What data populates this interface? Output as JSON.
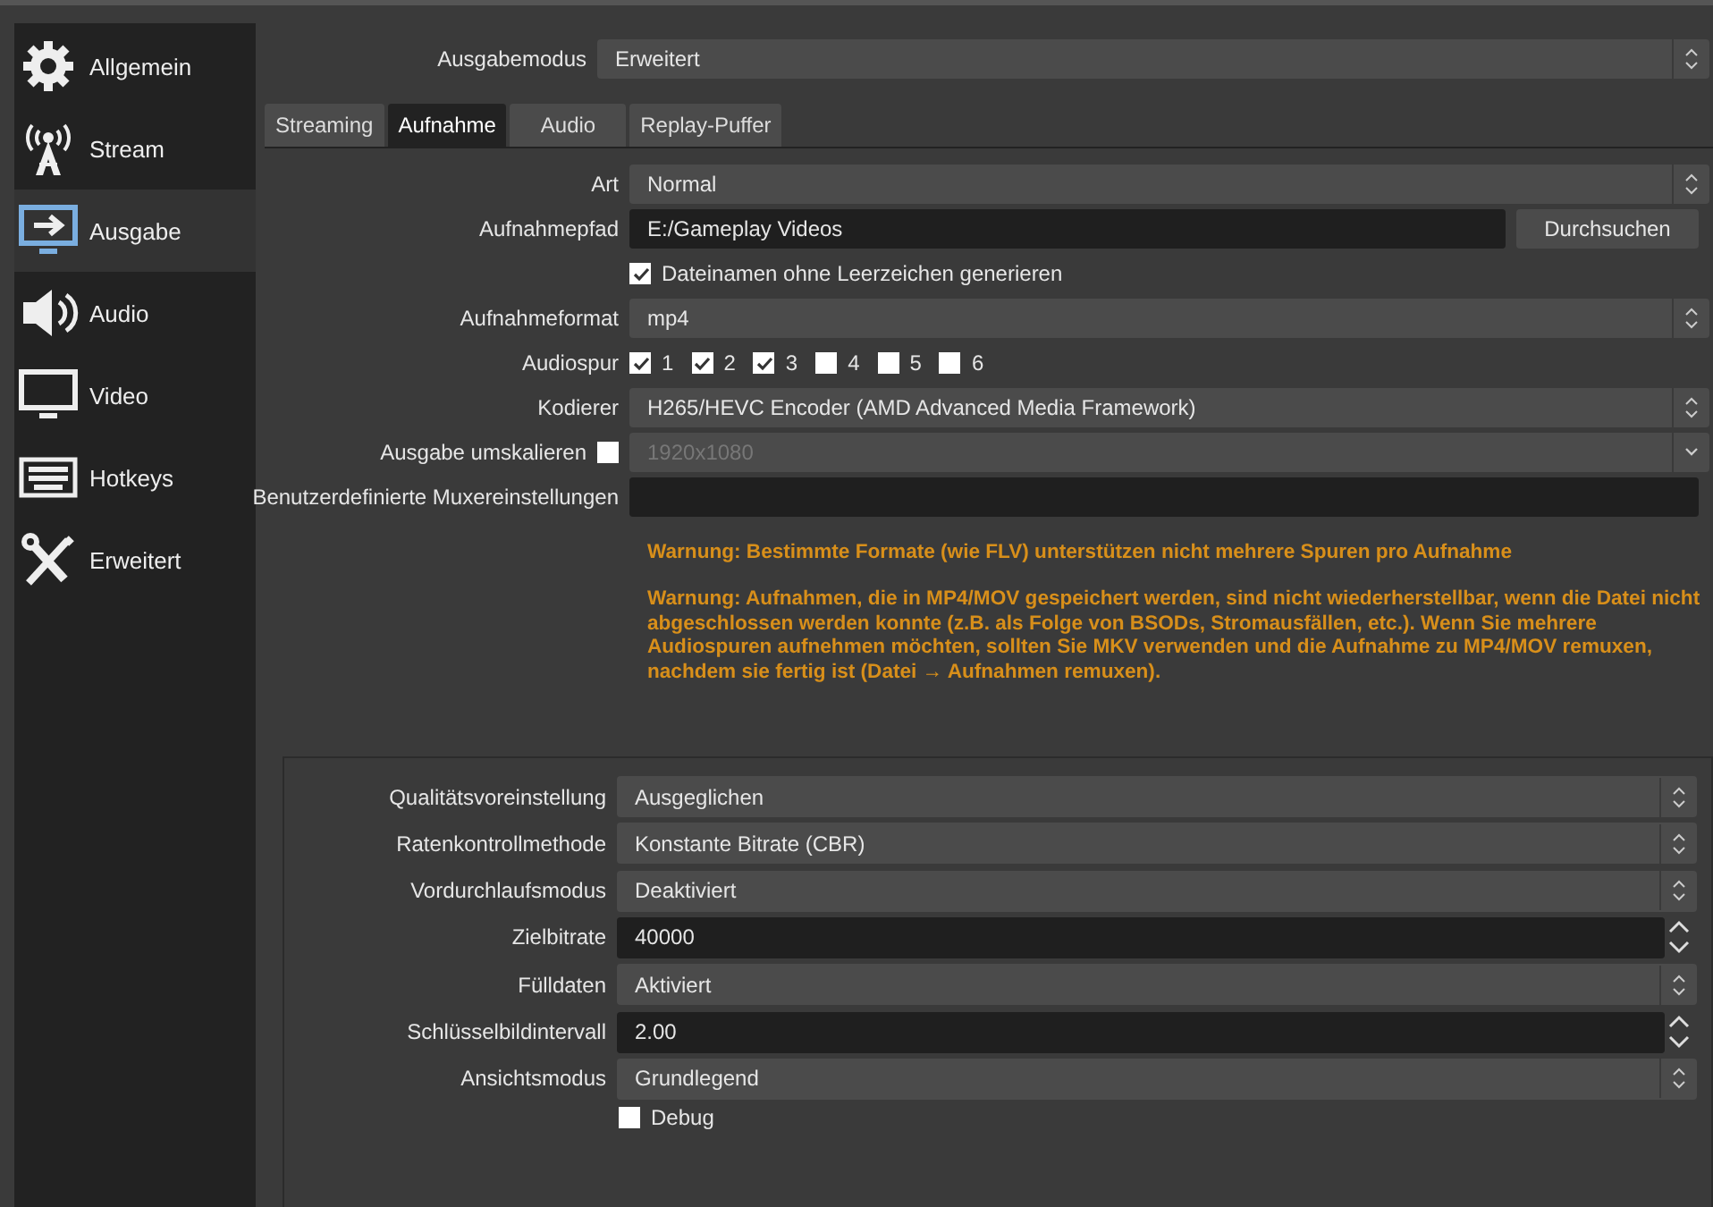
{
  "sidebar": {
    "items": [
      {
        "kind": "gear",
        "label": "Allgemein",
        "selected": false
      },
      {
        "kind": "antenna",
        "label": "Stream",
        "selected": false
      },
      {
        "kind": "output",
        "label": "Ausgabe",
        "selected": true
      },
      {
        "kind": "speaker",
        "label": "Audio",
        "selected": false
      },
      {
        "kind": "monitor",
        "label": "Video",
        "selected": false
      },
      {
        "kind": "keyboard",
        "label": "Hotkeys",
        "selected": false
      },
      {
        "kind": "tools",
        "label": "Erweitert",
        "selected": false
      }
    ]
  },
  "output_mode": {
    "label": "Ausgabemodus",
    "value": "Erweitert"
  },
  "tabs": [
    {
      "label": "Streaming",
      "selected": false
    },
    {
      "label": "Aufnahme",
      "selected": true
    },
    {
      "label": "Audio",
      "selected": false
    },
    {
      "label": "Replay-Puffer",
      "selected": false
    }
  ],
  "recording": {
    "rows": [
      {
        "kind": "combo",
        "label": "Art",
        "value": "Normal"
      },
      {
        "kind": "path",
        "label": "Aufnahmepfad",
        "value": "E:/Gameplay Videos",
        "button": "Durchsuchen"
      },
      {
        "kind": "checkbox",
        "label": "Dateinamen ohne Leerzeichen generieren",
        "checked": true
      },
      {
        "kind": "combo",
        "label": "Aufnahmeformat",
        "value": "mp4"
      },
      {
        "kind": "tracks",
        "label": "Audiospur",
        "tracks": [
          {
            "label": "1",
            "checked": true
          },
          {
            "label": "2",
            "checked": true
          },
          {
            "label": "3",
            "checked": true
          },
          {
            "label": "4",
            "checked": false
          },
          {
            "label": "5",
            "checked": false
          },
          {
            "label": "6",
            "checked": false
          }
        ]
      },
      {
        "kind": "combo",
        "label": "Kodierer",
        "value": "H265/HEVC Encoder (AMD Advanced Media Framework)"
      },
      {
        "kind": "rescale",
        "label": "Ausgabe umskalieren",
        "checked": false,
        "value": "1920x1080",
        "disabled": true
      },
      {
        "kind": "text",
        "label": "Benutzerdefinierte Muxereinstellungen"
      }
    ],
    "warnings": [
      "Warnung: Bestimmte Formate (wie FLV) unterstützen nicht mehrere Spuren pro Aufnahme",
      "Warnung: Aufnahmen, die in MP4/MOV gespeichert werden, sind nicht wiederherstellbar, wenn die Datei nicht abgeschlossen werden konnte (z.B. als Folge von BSODs, Stromausfällen, etc.). Wenn Sie mehrere Audiospuren aufnehmen möchten, sollten Sie MKV verwenden und die Aufnahme zu MP4/MOV remuxen, nachdem sie fertig ist (Datei → Aufnahmen remuxen)."
    ]
  },
  "encoder": {
    "rows": [
      {
        "kind": "combo",
        "label": "Qualitätsvoreinstellung",
        "value": "Ausgeglichen"
      },
      {
        "kind": "combo",
        "label": "Ratenkontrollmethode",
        "value": "Konstante Bitrate (CBR)"
      },
      {
        "kind": "combo",
        "label": "Vordurchlaufsmodus",
        "value": "Deaktiviert"
      },
      {
        "kind": "spin",
        "label": "Zielbitrate",
        "value": "40000"
      },
      {
        "kind": "combo",
        "label": "Fülldaten",
        "value": "Aktiviert"
      },
      {
        "kind": "spin",
        "label": "Schlüsselbildintervall",
        "value": "2.00"
      },
      {
        "kind": "combo",
        "label": "Ansichtsmodus",
        "value": "Grundlegend"
      }
    ],
    "debug": {
      "label": "Debug",
      "checked": false
    }
  }
}
